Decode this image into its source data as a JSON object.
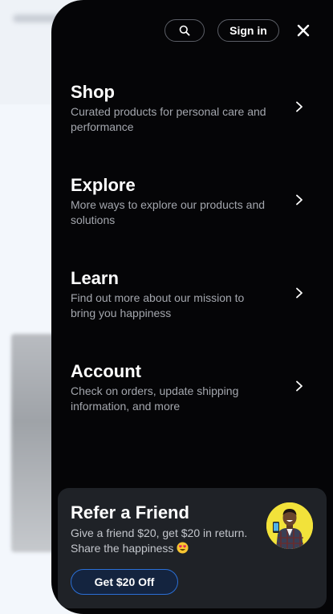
{
  "header": {
    "search_icon": "search-icon",
    "sign_in_label": "Sign in",
    "close_icon": "close-icon"
  },
  "menu": {
    "items": [
      {
        "title": "Shop",
        "description": "Curated products for personal care and performance",
        "icon": "chevron-right-icon"
      },
      {
        "title": "Explore",
        "description": "More ways to explore our products and solutions",
        "icon": "chevron-right-icon"
      },
      {
        "title": "Learn",
        "description": "Find out more about our mission to bring you happiness",
        "icon": "chevron-right-icon"
      },
      {
        "title": "Account",
        "description": "Check on orders, update shipping information, and more",
        "icon": "chevron-right-icon"
      }
    ]
  },
  "referral": {
    "title": "Refer a Friend",
    "description": "Give a friend $20, get $20 in return. Share the happiness",
    "emoji": "heart-eyes-emoji",
    "button_label": "Get $20 Off"
  },
  "colors": {
    "drawer_background": "#050507",
    "card_background": "#1f2227",
    "accent_blue": "#2b6fd6",
    "avatar_background": "#f2e23a"
  }
}
